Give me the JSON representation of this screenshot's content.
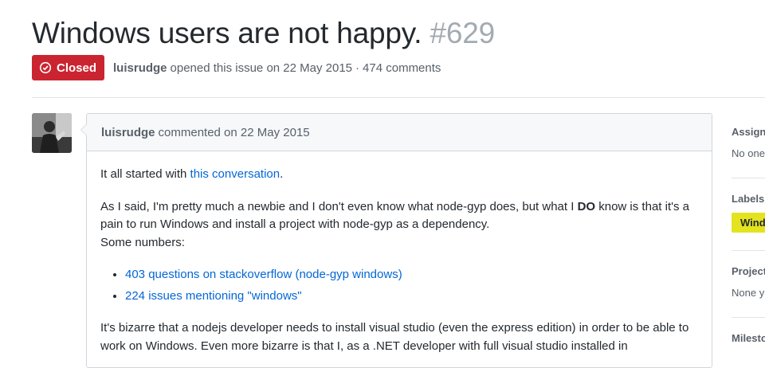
{
  "issue": {
    "title": "Windows users are not happy.",
    "number": "#629",
    "state": "Closed",
    "author": "luisrudge",
    "opened_text": "opened this issue on 22 May 2015",
    "separator": "·",
    "comments_count": "474 comments"
  },
  "comment": {
    "author": "luisrudge",
    "timestamp_text": "commented on 22 May 2015",
    "p1_before": "It all started with ",
    "p1_link": "this conversation",
    "p1_after": ".",
    "p2_before": "As I said, I'm pretty much a newbie and I don't even know what node-gyp does, but what I ",
    "p2_strong": "DO",
    "p2_after": " know is that it's a pain to run Windows and install a project with node-gyp as a dependency.",
    "p2_line2": "Some numbers:",
    "list": [
      "403 questions on stackoverflow (node-gyp windows)",
      "224 issues mentioning \"windows\""
    ],
    "p3": "It's bizarre that a nodejs developer needs to install visual studio (even the express edition) in order to be able to work on Windows. Even more bizarre is that I, as a .NET developer with full visual studio installed in"
  },
  "sidebar": {
    "assignees_heading": "Assigne",
    "assignees_value": "No one",
    "labels_heading": "Labels",
    "label_chip": "Wind",
    "label_color": "#e3e31f",
    "projects_heading": "Project",
    "projects_value": "None y",
    "milestone_heading": "Milesto"
  },
  "icons": {
    "state_icon": "issue-closed-icon"
  },
  "colors": {
    "closed_badge": "#cb2431",
    "link": "#0366d6"
  }
}
